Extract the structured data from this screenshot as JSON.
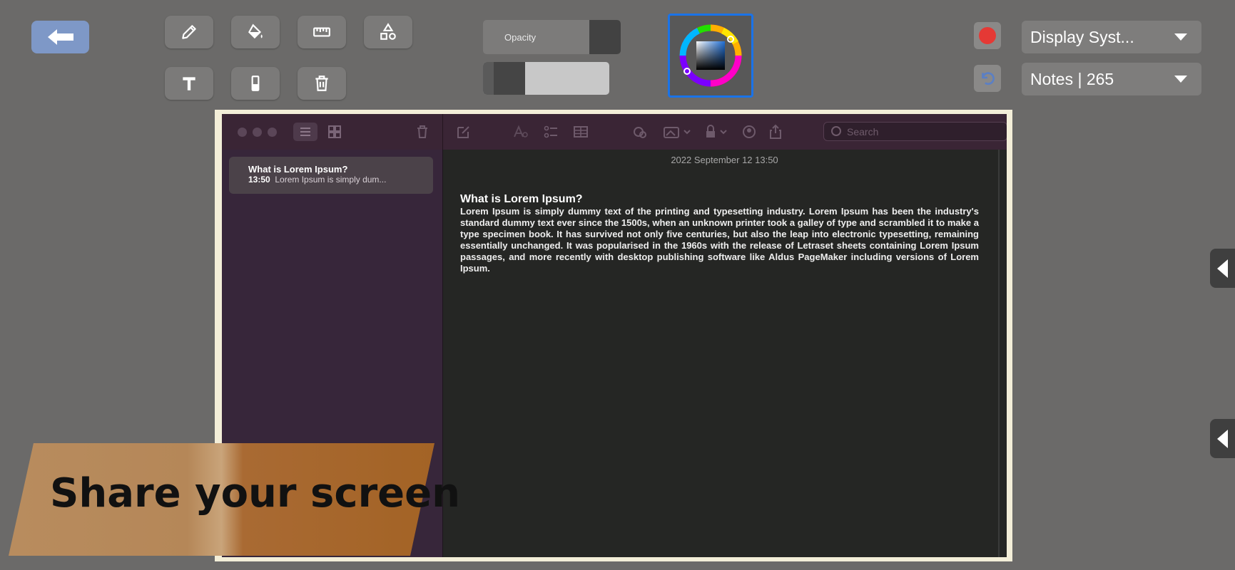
{
  "toolbar": {
    "opacity_label": "Opacity",
    "opacity_level": 0.25,
    "brush_size_level": 0.2,
    "record_color": "#e53935",
    "accent_color": "#1a73e8",
    "icons": [
      "back-arrow-icon",
      "pencil-icon",
      "paint-bucket-icon",
      "ruler-icon",
      "shapes-icon",
      "text-icon",
      "eraser-icon",
      "trash-icon",
      "color-wheel-icon",
      "record-icon",
      "undo-icon"
    ]
  },
  "dropdowns": {
    "display": "Display Syst...",
    "window": "Notes | 265"
  },
  "notes_app": {
    "search_placeholder": "Search",
    "list": [
      {
        "title": "What is Lorem Ipsum?",
        "time": "13:50",
        "preview": "Lorem Ipsum is simply dum..."
      }
    ],
    "date": "2022 September 12 13:50",
    "note_title": "What is Lorem Ipsum?",
    "note_text": "Lorem Ipsum is simply dummy text of the printing and typesetting industry. Lorem Ipsum has been the industry's standard dummy text ever since the 1500s, when an unknown printer took a galley of type and scrambled it to make a type specimen book. It has survived not only five centuries, but also the leap into electronic typesetting, remaining essentially unchanged. It was popularised in the 1960s with the release of Letraset sheets containing Lorem Ipsum passages, and more recently with desktop publishing software like Aldus PageMaker including versions of Lorem Ipsum."
  },
  "banner": {
    "text": "Share your screen"
  }
}
